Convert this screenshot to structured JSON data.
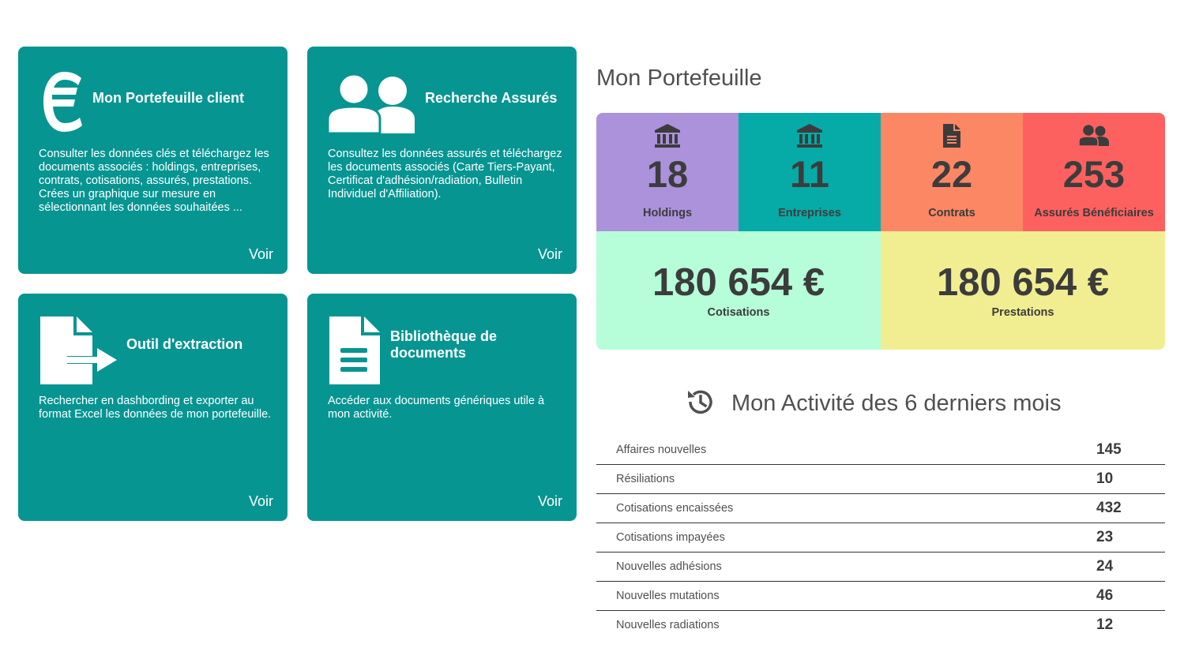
{
  "cards": [
    {
      "title": "Mon Portefeuille client",
      "description": "Consulter les données clés et téléchargez les documents associés : holdings, entreprises, contrats, cotisations, assurés, prestations. Crées un graphique sur mesure en sélectionnant les données souhaitées ...",
      "link": "Voir",
      "icon": "euro-icon"
    },
    {
      "title": "Recherche Assurés",
      "description": "Consultez les données assurés et téléchargez les documents associés (Carte Tiers-Payant, Certificat d'adhésion/radiation, Bulletin Individuel d'Affiliation).",
      "link": "Voir",
      "icon": "users-icon"
    },
    {
      "title": "Outil d'extraction",
      "description": "Rechercher en dashbording et exporter au format Excel les données de mon portefeuille.",
      "link": "Voir",
      "icon": "file-export-icon"
    },
    {
      "title": "Bibliothèque de documents",
      "description": "Accéder aux documents génériques utile à mon activité.",
      "link": "Voir",
      "icon": "document-icon"
    }
  ],
  "portfolio": {
    "title": "Mon Portefeuille",
    "kpis": [
      {
        "value": "18",
        "label": "Holdings",
        "color": "#ab92db",
        "icon": "bank-icon"
      },
      {
        "value": "11",
        "label": "Entreprises",
        "color": "#06aaa6",
        "icon": "bank-icon"
      },
      {
        "value": "22",
        "label": "Contrats",
        "color": "#fb8765",
        "icon": "file-icon"
      },
      {
        "value": "253",
        "label": "Assurés Bénéficiaires",
        "color": "#fc6160",
        "icon": "users-icon"
      }
    ],
    "totals": [
      {
        "value": "180 654 €",
        "label": "Cotisations",
        "color": "#b5fed9"
      },
      {
        "value": "180 654 €",
        "label": "Prestations",
        "color": "#f1ee92"
      }
    ]
  },
  "activity": {
    "title": "Mon Activité des 6 derniers mois",
    "icon": "history-icon",
    "rows": [
      {
        "label": "Affaires nouvelles",
        "value": "145"
      },
      {
        "label": "Résiliations",
        "value": "10"
      },
      {
        "label": "Cotisations encaissées",
        "value": "432"
      },
      {
        "label": "Cotisations impayées",
        "value": "23"
      },
      {
        "label": "Nouvelles adhésions",
        "value": "24"
      },
      {
        "label": "Nouvelles mutations",
        "value": "46"
      },
      {
        "label": "Nouvelles radiations",
        "value": "12"
      }
    ]
  }
}
